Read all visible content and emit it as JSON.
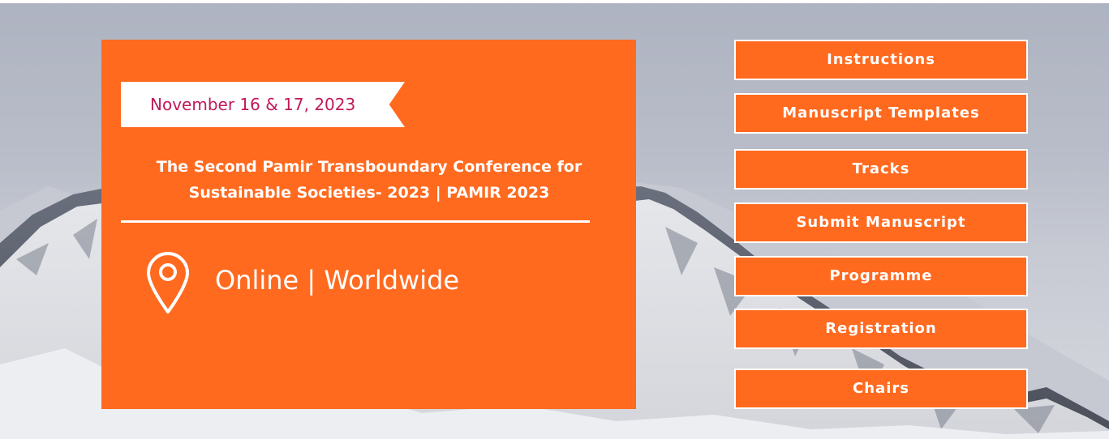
{
  "event": {
    "date": "November 16 & 17, 2023",
    "title": "The Second Pamir Transboundary Conference for Sustainable Societies- 2023 | PAMIR 2023",
    "location": "Online | Worldwide",
    "location_icon": "map-pin-icon"
  },
  "nav": {
    "items": [
      {
        "label": "Instructions"
      },
      {
        "label": "Manuscript Templates"
      },
      {
        "label": "Tracks"
      },
      {
        "label": "Submit Manuscript"
      },
      {
        "label": "Programme"
      },
      {
        "label": "Registration"
      },
      {
        "label": "Chairs"
      }
    ]
  },
  "colors": {
    "accent": "#ff6a1f",
    "date_text": "#c2185b",
    "text_light": "#ffffff"
  }
}
